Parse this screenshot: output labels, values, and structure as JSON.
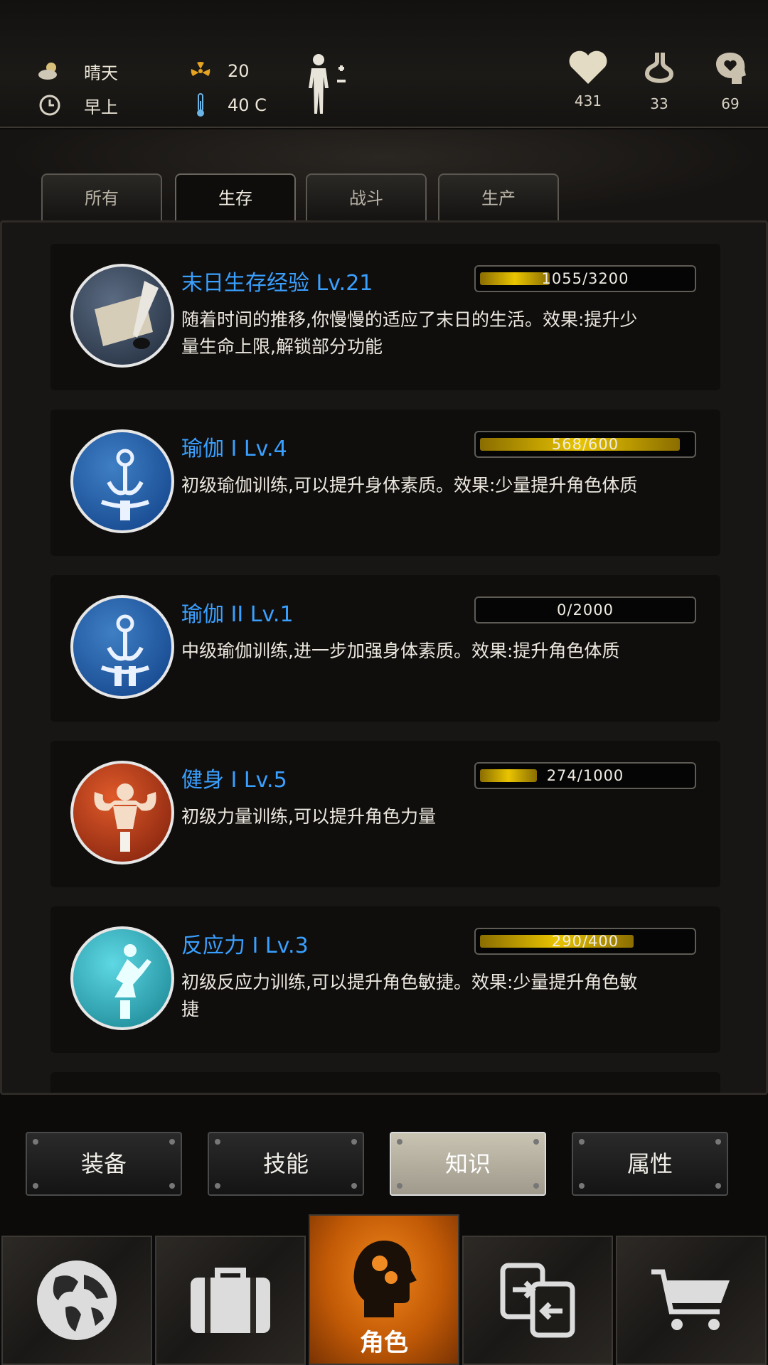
{
  "status": {
    "weather": "晴天",
    "time_of_day": "早上",
    "radiation": "20",
    "temperature": "40 C",
    "health": "431",
    "hunger": "33",
    "mental": "69"
  },
  "tabs": [
    {
      "label": "所有",
      "active": false
    },
    {
      "label": "生存",
      "active": true
    },
    {
      "label": "战斗",
      "active": false
    },
    {
      "label": "生产",
      "active": false
    }
  ],
  "skills": [
    {
      "name": "末日生存经验 Lv.21",
      "progress": "1055/3200",
      "fill": 0.33,
      "desc": "随着时间的推移,你慢慢的适应了末日的生活。效果:提升少量生命上限,解锁部分功能",
      "icon": "scroll-quill-icon"
    },
    {
      "name": "瑜伽 I Lv.4",
      "progress": "568/600",
      "fill": 0.95,
      "desc": "初级瑜伽训练,可以提升身体素质。效果:少量提升角色体质",
      "icon": "yoga-1-icon"
    },
    {
      "name": "瑜伽 II Lv.1",
      "progress": "0/2000",
      "fill": 0.0,
      "desc": "中级瑜伽训练,进一步加强身体素质。效果:提升角色体质",
      "icon": "yoga-2-icon"
    },
    {
      "name": "健身 I Lv.5",
      "progress": "274/1000",
      "fill": 0.27,
      "desc": "初级力量训练,可以提升角色力量",
      "icon": "bodybuilding-icon"
    },
    {
      "name": "反应力 I Lv.3",
      "progress": "290/400",
      "fill": 0.73,
      "desc": "初级反应力训练,可以提升角色敏捷。效果:少量提升角色敏捷",
      "icon": "reflex-icon"
    }
  ],
  "subnav": [
    {
      "label": "装备",
      "active": false
    },
    {
      "label": "技能",
      "active": false
    },
    {
      "label": "知识",
      "active": true
    },
    {
      "label": "属性",
      "active": false
    }
  ],
  "bottomnav": {
    "active_label": "角色",
    "items": [
      "globe-icon",
      "briefcase-icon",
      "head-gears-icon",
      "transfer-icon",
      "cart-icon"
    ]
  },
  "colors": {
    "skill_name": "#3aa0ff",
    "bar_fill": "#e9c400",
    "active_nav": "#e87a12"
  }
}
